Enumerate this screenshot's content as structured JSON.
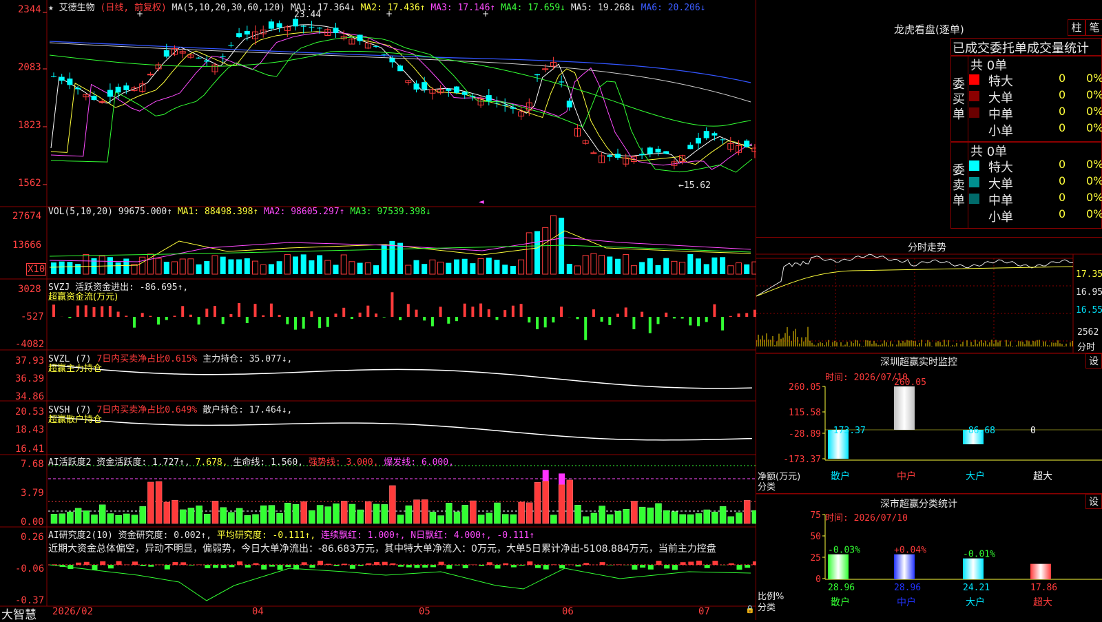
{
  "stock": {
    "name": "艾德生物",
    "period": "(日线, 前复权)",
    "ma_text": "MA(5,10,20,30,60,120)"
  },
  "ma": {
    "ma1": "MA1: 17.364↓",
    "ma2": "MA2: 17.436↑",
    "ma3": "MA3: 17.146↑",
    "ma4": "MA4: 17.659↓",
    "ma5": "MA5: 19.268↓",
    "ma6": "MA6: 20.206↓"
  },
  "price_axis": [
    "2344",
    "2083",
    "1823",
    "1562"
  ],
  "price_annot": {
    "high": "23.44",
    "low": "←15.62"
  },
  "vol": {
    "header": "VOL(5,10,20)",
    "value": "99675.000↑",
    "ma1": "MA1: 88498.398↑",
    "ma2": "MA2: 98605.297↑",
    "ma3": "MA3: 97539.398↓",
    "axis": [
      "27674",
      "13666"
    ],
    "unit": "X10"
  },
  "svzj": {
    "header": "SVZJ",
    "text": "活跃资金进出: -86.695↑,",
    "sub": "超赢资金流(万元)",
    "axis": [
      "3028",
      "-527",
      "-4082"
    ]
  },
  "svzl": {
    "header": "SVZL (7)",
    "sub_red": "7日内买卖净占比0.615%",
    "sub_wht": "主力持仓: 35.077↓,",
    "sub2": "超赢主力持仓",
    "axis": [
      "37.93",
      "36.39",
      "34.86"
    ]
  },
  "svsh": {
    "header": "SVSH (7)",
    "sub_red": "7日内买卖净占比0.649%",
    "sub_wht": "散户持仓: 17.464↓,",
    "sub2": "超赢散户持仓",
    "axis": [
      "20.53",
      "18.43",
      "16.41"
    ]
  },
  "ai_act": {
    "header": "AI活跃度2",
    "t1": "资金活跃度: 1.727↑,",
    "t2": "7.678,",
    "t3": "生命线: 1.560,",
    "t4": "强势线: 3.000,",
    "t5": "爆发线: 6.000,",
    "axis": [
      "7.68",
      "3.79",
      "0.00"
    ]
  },
  "ai_res": {
    "header": "AI研究度2(10)",
    "t1": "资金研究度: 0.002↑,",
    "t2": "平均研究度: -0.111↑,",
    "t3": "连续飘红: 1.000↑,",
    "t4": "N日飘红: 4.000↑,",
    "t5": "-0.111↑",
    "comment": "近期大资金总体偏空，异动不明显，偏弱势，今日大单净流出：-86.683万元，其中特大单净流入：0万元，大单5日累计净出-5108.884万元，当前主力控盘",
    "axis": [
      "0.26",
      "-0.06",
      "-0.37"
    ]
  },
  "dates": {
    "d1": "2026/02",
    "d2": "04",
    "d3": "05",
    "d4": "06",
    "d5": "07"
  },
  "brand": "大智慧",
  "lhb": {
    "title": "龙虎看盘(逐单)",
    "btn1": "柱",
    "btn2": "笔",
    "stat_title": "已成交委托单成交量统计",
    "buy_label": "委买单",
    "sell_label": "委卖单",
    "buy_total": "共 0单",
    "sell_total": "共 0单",
    "buy_rows": [
      {
        "name": "特大",
        "v": "0",
        "p": "0%",
        "c": "#ff0000"
      },
      {
        "name": "大单",
        "v": "0",
        "p": "0%",
        "c": "#8b0000"
      },
      {
        "name": "中单",
        "v": "0",
        "p": "0%",
        "c": "#6b0000"
      },
      {
        "name": "小单",
        "v": "0",
        "p": "0%",
        "c": "#000000"
      }
    ],
    "sell_rows": [
      {
        "name": "特大",
        "v": "0",
        "p": "0%",
        "c": "#00ffff"
      },
      {
        "name": "大单",
        "v": "0",
        "p": "0%",
        "c": "#009090"
      },
      {
        "name": "中单",
        "v": "0",
        "p": "0%",
        "c": "#006b6b"
      },
      {
        "name": "小单",
        "v": "0",
        "p": "0%",
        "c": "#000000"
      }
    ]
  },
  "fenshi": {
    "title": "分时走势",
    "axis": [
      "17.35",
      "16.95",
      "16.55"
    ],
    "vol1": "2562",
    "vol2": "分时"
  },
  "monitor": {
    "title": "深圳超赢实时监控",
    "btn": "设",
    "time": "时间: 2026/07/10",
    "axis": [
      "260.05",
      "115.58",
      "-28.89",
      "-173.37"
    ],
    "ylabel": "净额(万元)",
    "xlabel": "分类",
    "cats": [
      "散户",
      "中户",
      "大户",
      "超大"
    ],
    "values": [
      "-173.37",
      "260.05",
      "-86.68",
      "0"
    ]
  },
  "classify": {
    "title": "深市超赢分类统计",
    "btn": "设",
    "time": "时间: 2026/07/10",
    "axis": [
      "75",
      "50",
      "25",
      "0"
    ],
    "ylabel": "比例%",
    "xlabel": "分类",
    "cats": [
      "散户",
      "中户",
      "大户",
      "超大"
    ],
    "top": [
      "-0.03%",
      "+0.04%",
      "-0.01%",
      ""
    ],
    "bottom": [
      "28.96",
      "28.96",
      "24.21",
      "17.86"
    ]
  }
}
